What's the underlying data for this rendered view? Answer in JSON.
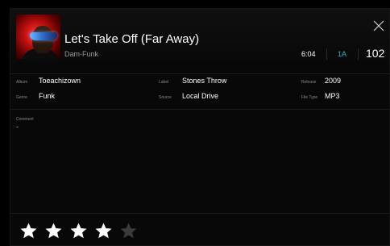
{
  "track": {
    "title": "Let's Take Off (Far Away)",
    "artist": "Dam-Funk",
    "duration": "6:04",
    "key": "1A",
    "bpm": "102",
    "artwork_icon": "album-art-image"
  },
  "meta": {
    "album_label": "Album",
    "album": "Toeachizown",
    "label_label": "Label",
    "label": "Stones Throw",
    "release_label": "Release",
    "release": "2009",
    "genre_label": "Genre",
    "genre": "Funk",
    "source_label": "Source",
    "source": "Local Drive",
    "filetype_label": "File Type",
    "filetype": "MP3"
  },
  "comment": {
    "label": "Comment",
    "value": "-"
  },
  "rating": {
    "value": 4,
    "max": 5,
    "filled_color": "#ffffff",
    "empty_color": "#3a3a3a"
  },
  "colors": {
    "key_accent": "#25b6c9",
    "background": "#080808"
  },
  "icons": {
    "close": "close-icon",
    "star": "star-icon"
  }
}
